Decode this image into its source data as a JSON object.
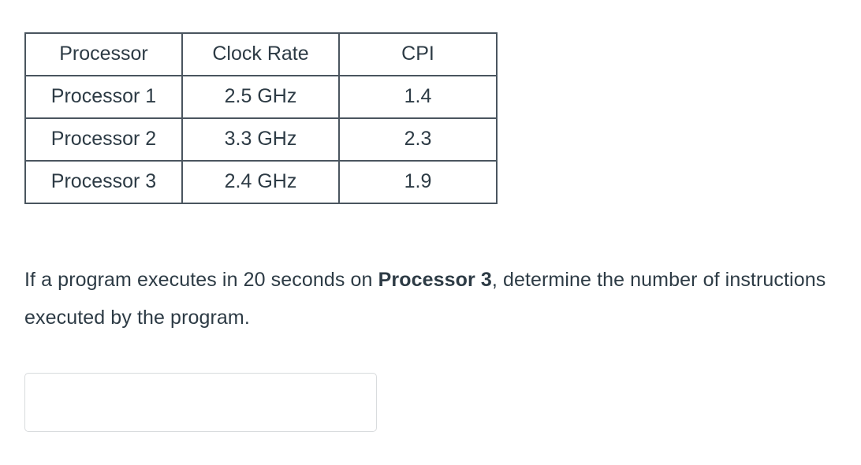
{
  "table": {
    "headers": [
      "Processor",
      "Clock Rate",
      "CPI"
    ],
    "rows": [
      {
        "processor": "Processor 1",
        "clock_rate": "2.5 GHz",
        "cpi": "1.4"
      },
      {
        "processor": "Processor 2",
        "clock_rate": "3.3 GHz",
        "cpi": "2.3"
      },
      {
        "processor": "Processor 3",
        "clock_rate": "2.4 GHz",
        "cpi": "1.9"
      }
    ]
  },
  "question": {
    "text_before": "If a program executes in 20 seconds on ",
    "emphasis": "Processor 3",
    "text_after": ", determine the number of instructions executed by the program."
  },
  "answer": {
    "value": "",
    "placeholder": ""
  },
  "colors": {
    "text": "#2d3b45",
    "table_border": "#4a555f",
    "input_border": "#d9dcde",
    "background": "#ffffff"
  }
}
